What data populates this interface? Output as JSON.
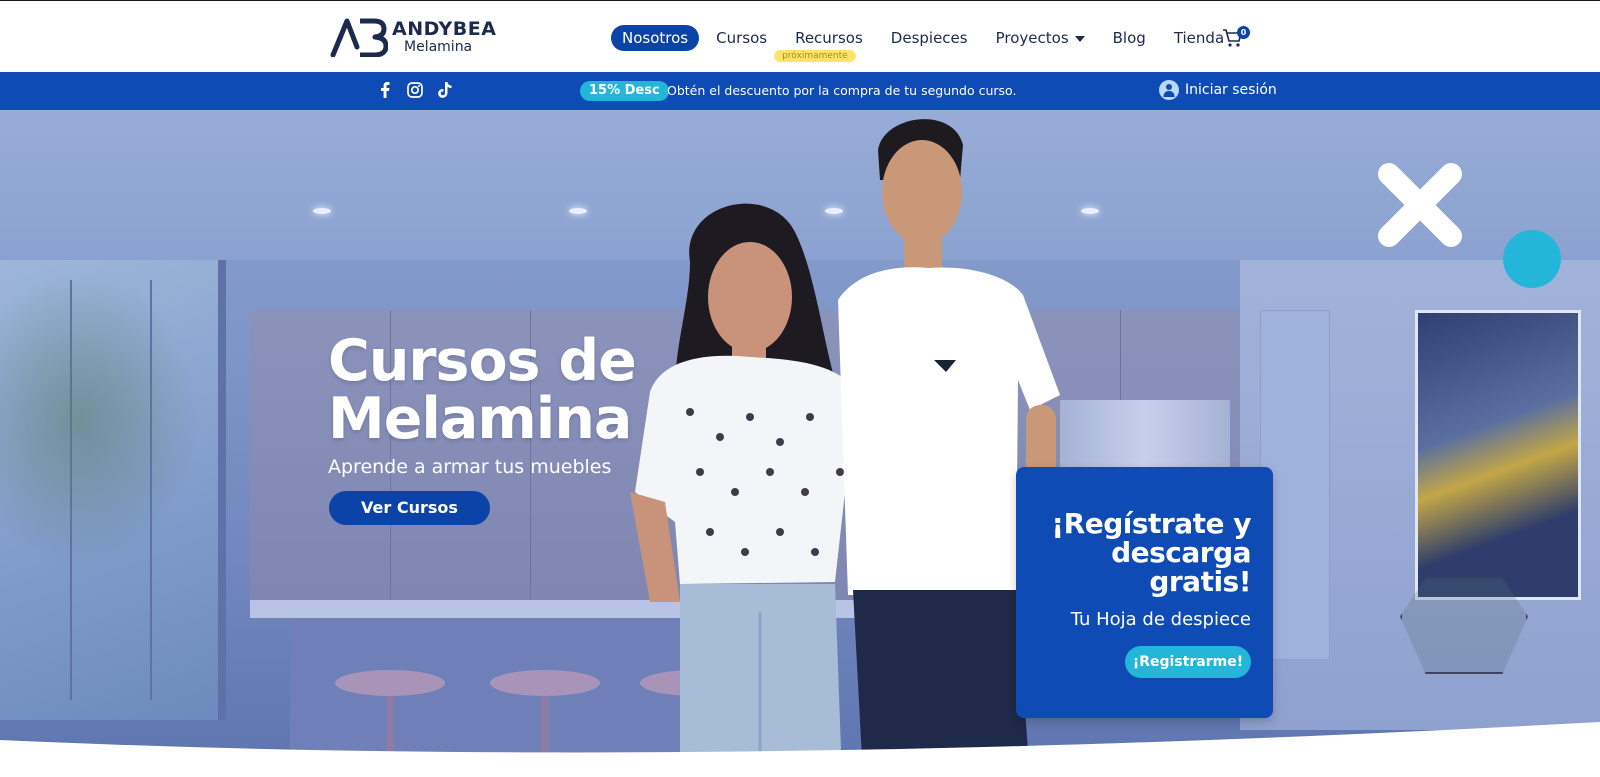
{
  "brand": {
    "name": "ANDYBEA",
    "sub": "Melamina"
  },
  "nav": {
    "items": [
      {
        "label": "Nosotros",
        "active": true
      },
      {
        "label": "Cursos"
      },
      {
        "label": "Recursos",
        "badge": "próximamente"
      },
      {
        "label": "Despieces"
      },
      {
        "label": "Proyectos",
        "has_dropdown": true
      },
      {
        "label": "Blog"
      },
      {
        "label": "Tienda"
      }
    ],
    "cart_count": "0"
  },
  "promo": {
    "social": [
      "facebook-icon",
      "instagram-icon",
      "tiktok-icon"
    ],
    "pill": "15% Desc",
    "text": "Obtén el descuento por la compra de tu segundo curso.",
    "login": "Iniciar sesión"
  },
  "hero": {
    "title": "Cursos de Melamina",
    "subtitle": "Aprende a armar tus muebles",
    "button": "Ver Cursos"
  },
  "register_card": {
    "title": "¡Regístrate y descarga gratis!",
    "subtitle": "Tu Hoja de despiece",
    "button": "¡Registrarme!"
  },
  "colors": {
    "primary": "#0b43a8",
    "promo_bar": "#0e4bb5",
    "accent": "#23b6d9",
    "badge": "#ffe46b",
    "dark_text": "#1c2a4e"
  }
}
